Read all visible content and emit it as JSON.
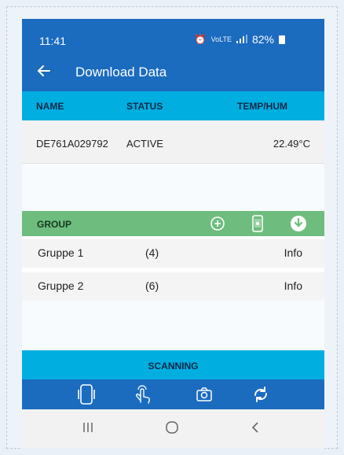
{
  "status_bar": {
    "time": "11:41",
    "signal_text": "VoLTE",
    "battery": "82%"
  },
  "app_bar": {
    "title": "Download Data"
  },
  "device_table": {
    "headers": [
      "NAME",
      "STATUS",
      "TEMP/HUM"
    ],
    "rows": [
      {
        "name": "DE761A029792",
        "status": "ACTIVE",
        "temp": "22.49°C"
      }
    ]
  },
  "group_section": {
    "header": "GROUP",
    "icons": [
      "add-circle-icon",
      "phone-device-icon",
      "download-icon"
    ],
    "rows": [
      {
        "name": "Gruppe 1",
        "count": "(4)",
        "action": "Info"
      },
      {
        "name": "Gruppe 2",
        "count": "(6)",
        "action": "Info"
      }
    ]
  },
  "scanning": {
    "label": "SCANNING"
  },
  "bottom_bar": {
    "icons": [
      "phone-scan-icon",
      "touch-icon",
      "camera-icon",
      "sync-icon"
    ]
  },
  "nav_bar": {
    "icons": [
      "recents-icon",
      "home-icon",
      "back-nav-icon"
    ]
  },
  "colors": {
    "primary": "#1b6bbf",
    "cyan": "#00aee0",
    "green": "#6ebd7e"
  }
}
